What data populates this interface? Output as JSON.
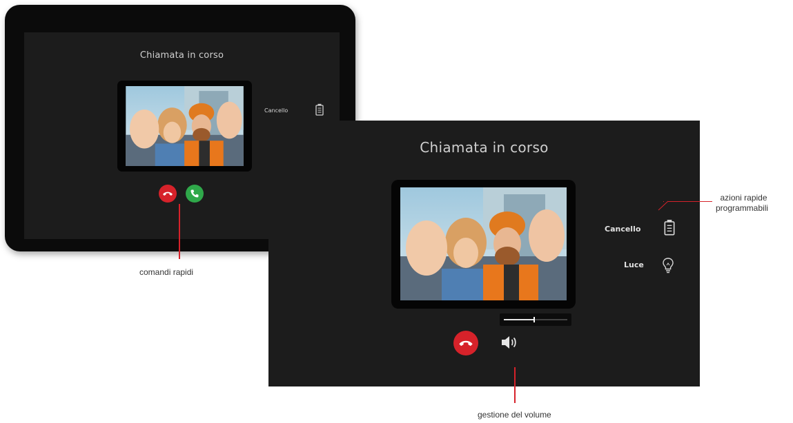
{
  "small_device": {
    "title": "Chiamata in corso",
    "side_action": {
      "label": "Cancello",
      "icon": "gate-icon"
    },
    "buttons": [
      {
        "name": "hangup",
        "icon": "phone-hangup-icon",
        "color": "#d6222a"
      },
      {
        "name": "answer",
        "icon": "phone-answer-icon",
        "color": "#2fa84a"
      }
    ]
  },
  "large_device": {
    "title": "Chiamata in corso",
    "quick_actions": [
      {
        "label": "Cancello",
        "icon": "gate-icon"
      },
      {
        "label": "Luce",
        "icon": "lightbulb-icon"
      }
    ],
    "volume_level": 0.48,
    "buttons": [
      {
        "name": "hangup",
        "icon": "phone-hangup-icon",
        "color": "#d6222a"
      },
      {
        "name": "speaker",
        "icon": "speaker-icon"
      }
    ]
  },
  "annotations": {
    "quick_commands": "comandi rapidi",
    "quick_actions_line1": "azioni rapide",
    "quick_actions_line2": "programmabili",
    "volume": "gestione del volume"
  },
  "colors": {
    "accent_red": "#d6222a",
    "answer_green": "#2fa84a",
    "screen_bg": "#1c1c1c"
  }
}
